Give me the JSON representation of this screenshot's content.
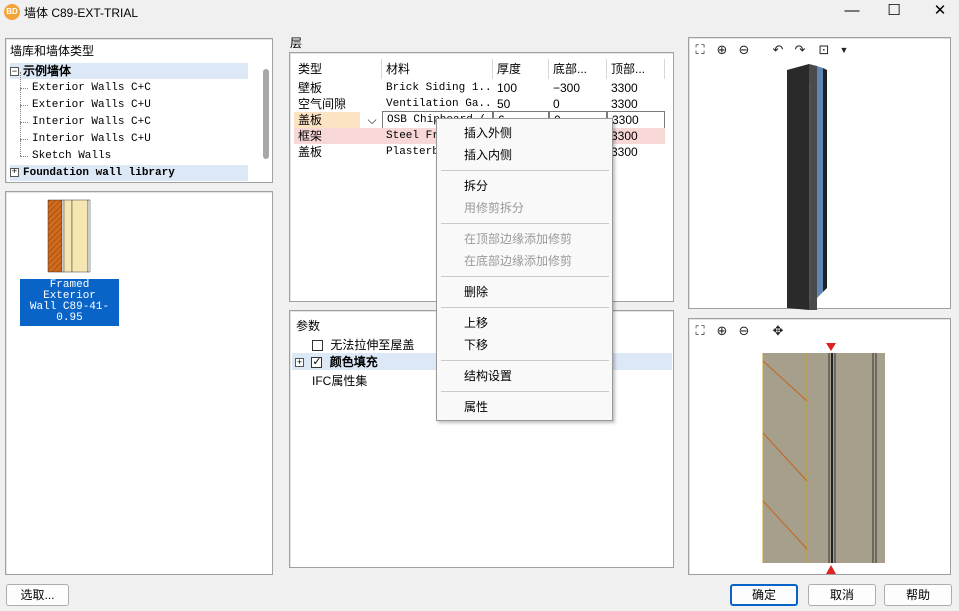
{
  "window": {
    "icon_text": "BD",
    "title": "墙体 C89-EXT-TRIAL",
    "minimize": "—",
    "maximize": "☐",
    "close": "✕"
  },
  "tree": {
    "header": "墙库和墙体类型",
    "group1_label": "示例墙体",
    "group1_toggle": "−",
    "items": [
      "Exterior Walls C+C",
      "Exterior Walls C+U",
      "Interior Walls C+C",
      "Interior Walls C+U",
      "Sketch Walls"
    ],
    "group2_label": "Foundation wall library",
    "group2_toggle": "+"
  },
  "thumbnail": {
    "caption_line1": "Framed Exterior",
    "caption_line2": "Wall C89-41-0.95"
  },
  "layers": {
    "label": "层",
    "columns": [
      "类型",
      "材料",
      "厚度",
      "底部...",
      "顶部..."
    ],
    "rows": [
      {
        "type": "壁板",
        "material": "Brick Siding 1...",
        "thickness": "100",
        "bottom": "−300",
        "top": "3300"
      },
      {
        "type": "空气间隙",
        "material": "Ventilation Ga...",
        "thickness": "50",
        "bottom": "0",
        "top": "3300"
      },
      {
        "type": "盖板",
        "material": "OSB Chipboard (...",
        "thickness": "6",
        "bottom": "0",
        "top": "3300"
      },
      {
        "type": "框架",
        "material": "Steel Fra",
        "thickness": "",
        "bottom": "",
        "top": "3300"
      },
      {
        "type": "盖板",
        "material": "Plasterbo",
        "thickness": "",
        "bottom": "",
        "top": "3300"
      }
    ]
  },
  "params": {
    "header": "参数",
    "item1": "无法拉伸至屋盖",
    "item2": "颜色填充",
    "item2_toggle": "+",
    "item3": "IFC属性集"
  },
  "context_menu": {
    "items": [
      "插入外侧",
      "插入内侧",
      "拆分",
      "用修剪拆分",
      "在顶部边缘添加修剪",
      "在底部边缘添加修剪",
      "删除",
      "上移",
      "下移",
      "结构设置",
      "属性"
    ]
  },
  "buttons": {
    "select": "选取...",
    "ok": "确定",
    "cancel": "取消",
    "help": "帮助"
  },
  "colors": {
    "accent": "#0a64c8",
    "tree_selection": "#dde8f6",
    "pink_row": "#f8d7d7"
  }
}
